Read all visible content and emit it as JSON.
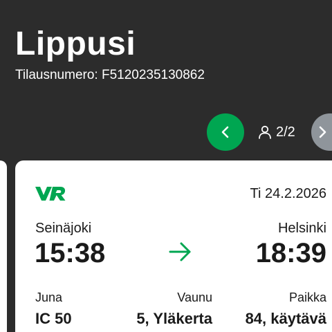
{
  "header": {
    "title": "Lippusi",
    "order_label": "Tilausnumero:",
    "order_number": "F5120235130862"
  },
  "pager": {
    "current": "2/2",
    "prev_icon": "chevron-left-icon",
    "next_icon": "chevron-right-icon",
    "passenger_icon": "person-icon"
  },
  "ticket": {
    "brand": "VR",
    "date": "Ti 24.2.2026",
    "departure": {
      "station": "Seinäjoki",
      "time": "15:38"
    },
    "arrival": {
      "station": "Helsinki",
      "time": "18:39"
    },
    "details": {
      "train_label": "Juna",
      "train_value": "IC 50",
      "wagon_label": "Vaunu",
      "wagon_value": "5, Yläkerta",
      "seat_label": "Paikka",
      "seat_value": "84, käytävä"
    }
  },
  "colors": {
    "background": "#2c2c2c",
    "accent_green": "#00a651",
    "button_gray": "#8f959b",
    "card": "#ffffff"
  }
}
